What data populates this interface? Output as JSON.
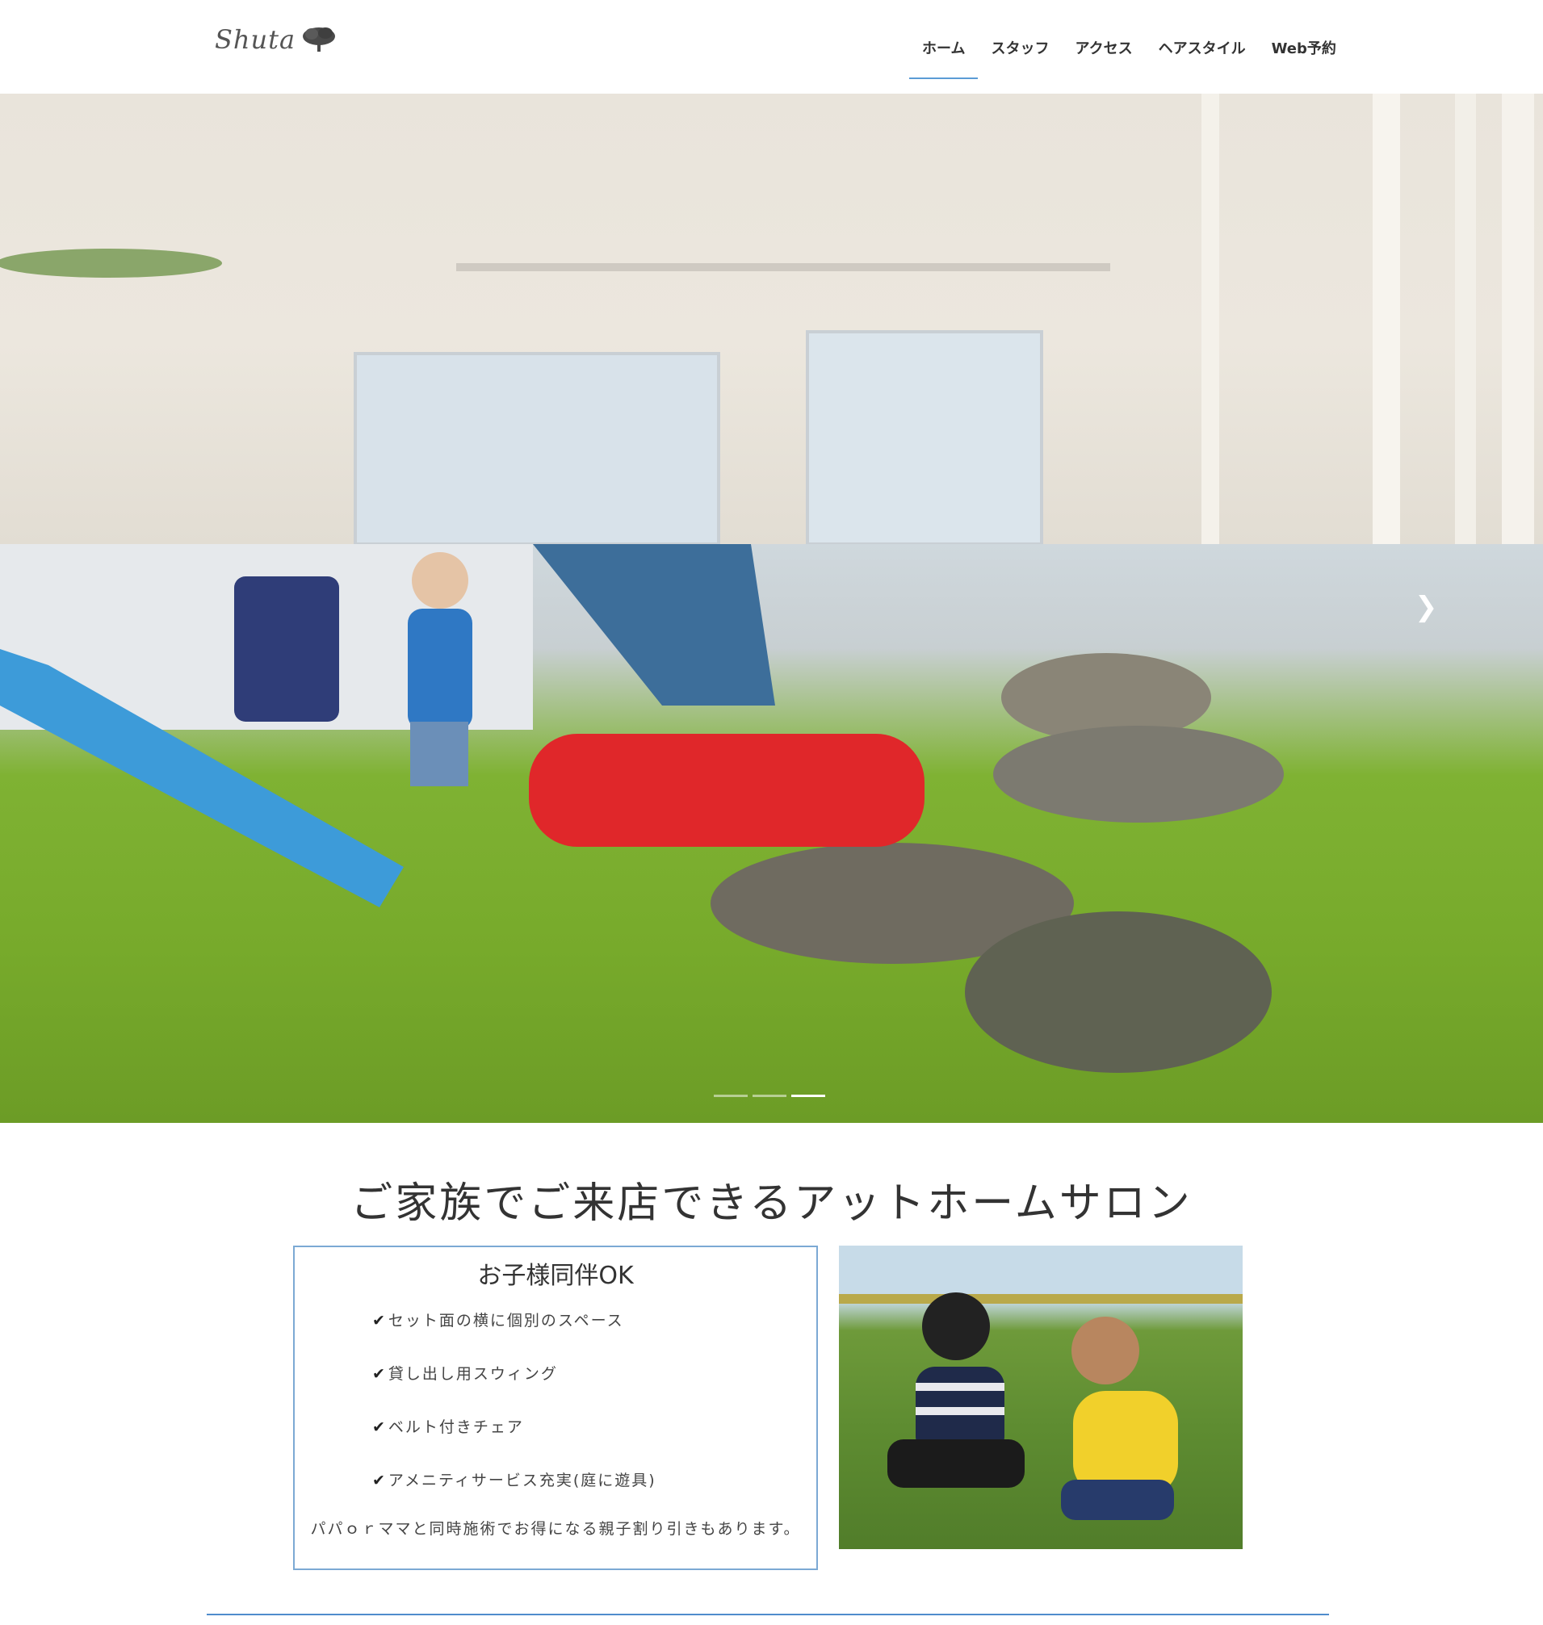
{
  "header": {
    "logo_text": "Shuta",
    "nav": [
      {
        "label": "ホーム",
        "active": true
      },
      {
        "label": "スタッフ",
        "active": false
      },
      {
        "label": "アクセス",
        "active": false
      },
      {
        "label": "ヘアスタイル",
        "active": false
      },
      {
        "label": "Web予約",
        "active": false
      }
    ]
  },
  "hero": {
    "next_icon": "chevron-right-icon",
    "slide_count": 3,
    "active_slide": 3
  },
  "section": {
    "title": "ご家族でご来店できるアットホームサロン",
    "box_title": "お子様同伴OK",
    "check_icon": "check-icon",
    "features": [
      "セット面の横に個別のスペース",
      "貸し出し用スウィング",
      "ベルト付きチェア",
      "アメニティサービス充実(庭に遊具)"
    ],
    "note": "パパｏｒママと同時施術でお得になる親子割り引きもあります。"
  },
  "colors": {
    "accent": "#5b9bd5",
    "box_border": "#7ca9d4",
    "divider": "#4f8ccc"
  }
}
